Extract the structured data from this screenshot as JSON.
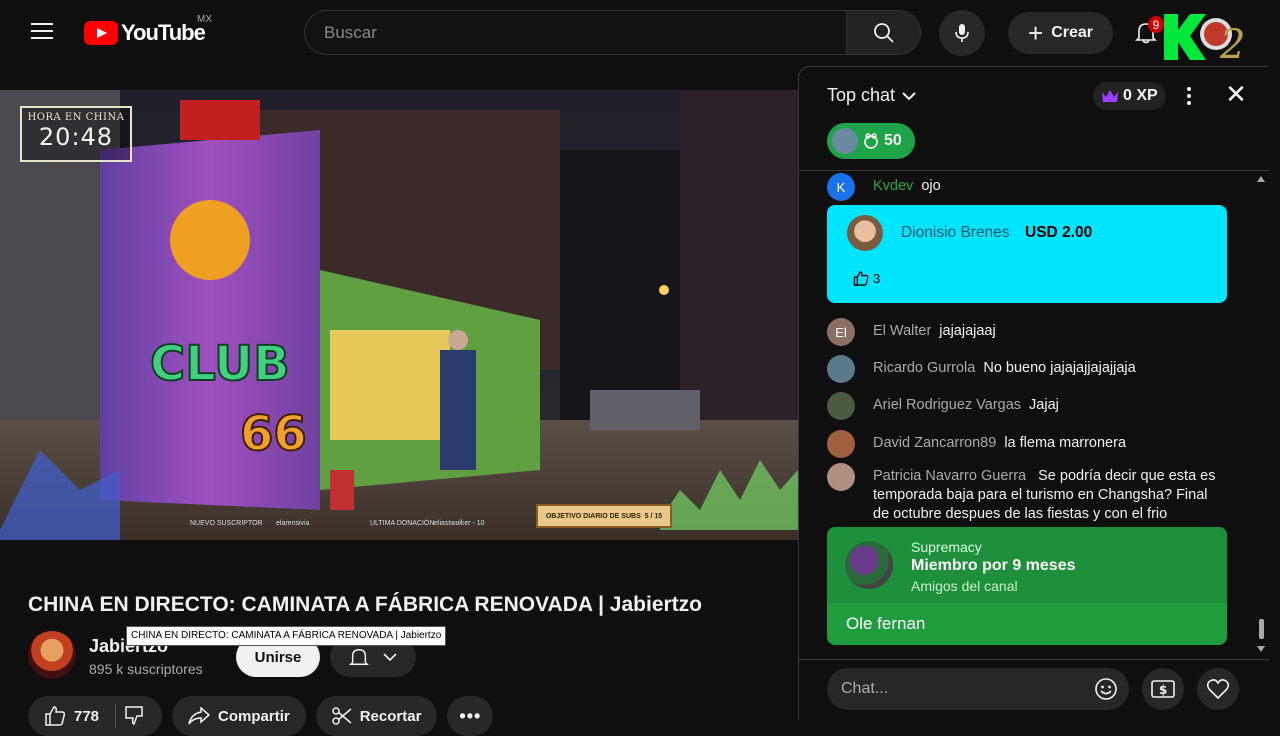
{
  "header": {
    "logo_text": "YouTube",
    "region": "MX",
    "search_placeholder": "Buscar",
    "create_label": "Crear",
    "notifications_count": "9"
  },
  "video": {
    "clock_label": "HORA EN CHINA",
    "clock_time": "20:48",
    "new_sub_label": "NUEVO SUSCRIPTOR",
    "new_sub_name": "elarensivia",
    "last_donation_label": "ULTIMA DONACIÓN",
    "last_donation_name": "eliastwalker - 10",
    "sub_goal_label": "OBJETIVO DIARIO DE SUBS",
    "sub_goal_value": "5 / 15",
    "title": "CHINA EN DIRECTO: CAMINATA A FÁBRICA RENOVADA | Jabiertzo",
    "tooltip": "CHINA EN DIRECTO: CAMINATA A FÁBRICA RENOVADA | Jabiertzo"
  },
  "channel": {
    "name": "Jabiertzo",
    "subscribers": "895 k suscriptores",
    "join_label": "Unirse"
  },
  "actions": {
    "likes": "778",
    "share_label": "Compartir",
    "clip_label": "Recortar"
  },
  "chat": {
    "mode_label": "Top chat",
    "xp_label": "0 XP",
    "pinned_count": "50",
    "messages": [
      {
        "initial": "K",
        "author": "Kvdev",
        "text": "ojo",
        "color": "#1a73e8"
      },
      {
        "initial": "El",
        "author": "El Walter",
        "text": "jajajajaaj",
        "color": "#8d6e63"
      },
      {
        "initial": "",
        "author": "Ricardo Gurrola",
        "text": "No bueno jajajajjajajjaja",
        "color": "#5a7a8a"
      },
      {
        "initial": "",
        "author": "Ariel Rodriguez Vargas",
        "text": "Jajaj",
        "color": "#4a5a40"
      },
      {
        "initial": "",
        "author": "David Zancarron89",
        "text": "la flema marronera",
        "color": "#a06040"
      },
      {
        "initial": "",
        "author": "Patricia Navarro Guerra",
        "text": "Se podría decir que esta es temporada baja para el turismo en Changsha? Final de octubre despues de las fiestas y con el frio",
        "color": "#b09080"
      }
    ],
    "superchat": {
      "author": "Dionisio Brenes",
      "amount": "USD 2.00",
      "likes": "3",
      "color": "#00e5ff"
    },
    "membership": {
      "author": "Supremacy",
      "milestone": "Miembro por 9 meses",
      "subtitle": "Amigos del canal",
      "text": "Ole fernan",
      "color": "#1f9d3e"
    },
    "input_placeholder": "Chat..."
  }
}
